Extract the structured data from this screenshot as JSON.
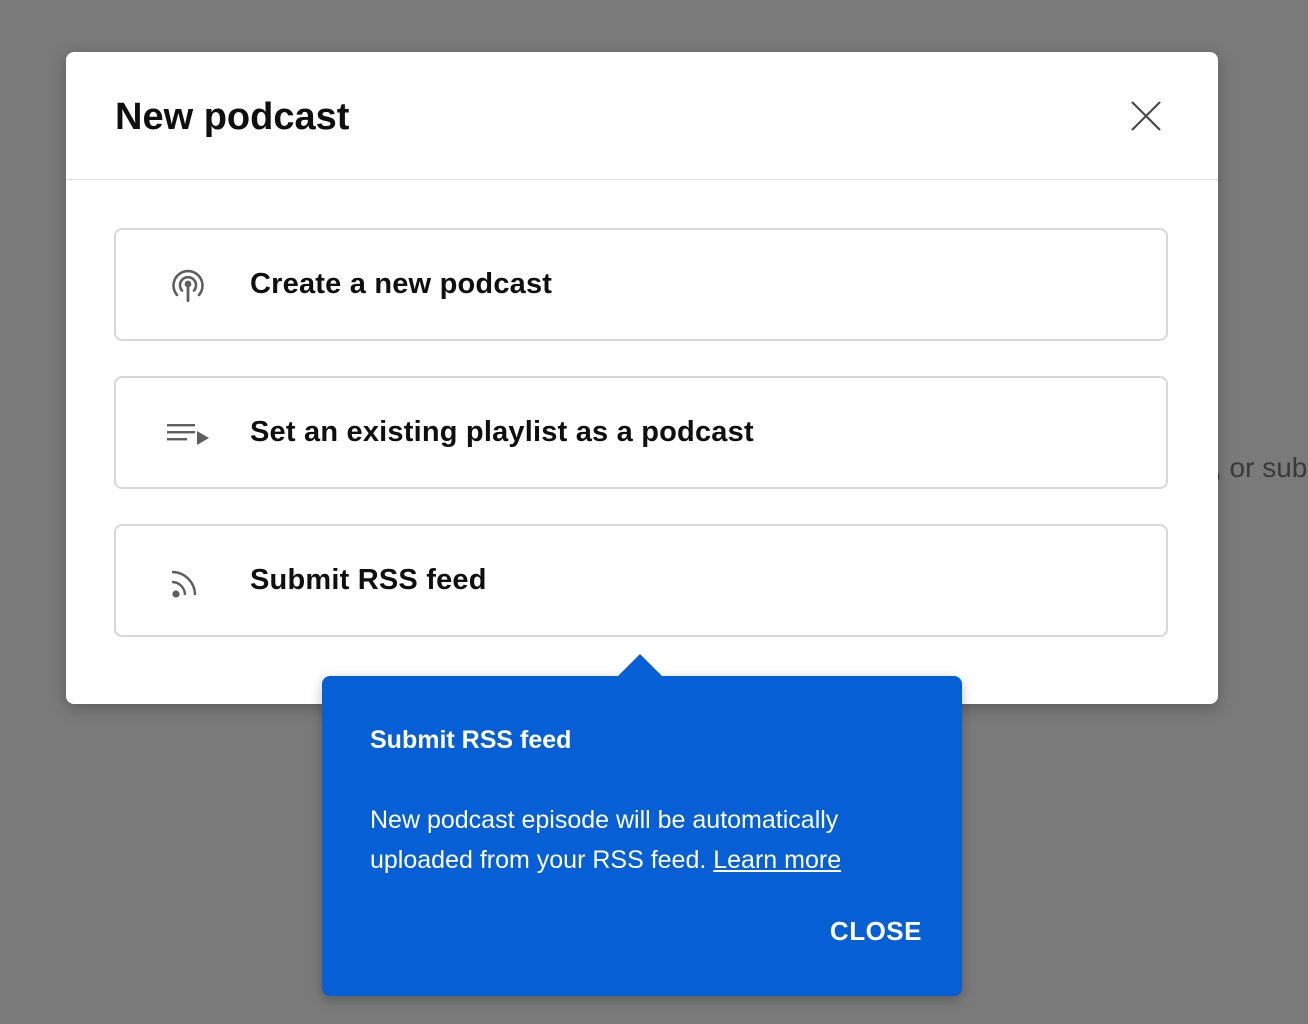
{
  "background": {
    "partial_text": ", or sub"
  },
  "modal": {
    "title": "New podcast",
    "close_icon": "close-icon",
    "options": [
      {
        "icon": "podcast-icon",
        "label": "Create a new podcast"
      },
      {
        "icon": "playlist-play-icon",
        "label": "Set an existing playlist as a podcast"
      },
      {
        "icon": "rss-feed-icon",
        "label": "Submit RSS feed"
      }
    ]
  },
  "tooltip": {
    "title": "Submit RSS feed",
    "body": "New podcast episode will be automatically uploaded from your RSS feed.",
    "link_label": "Learn more",
    "close_label": "CLOSE",
    "background_color": "#065fd4"
  }
}
